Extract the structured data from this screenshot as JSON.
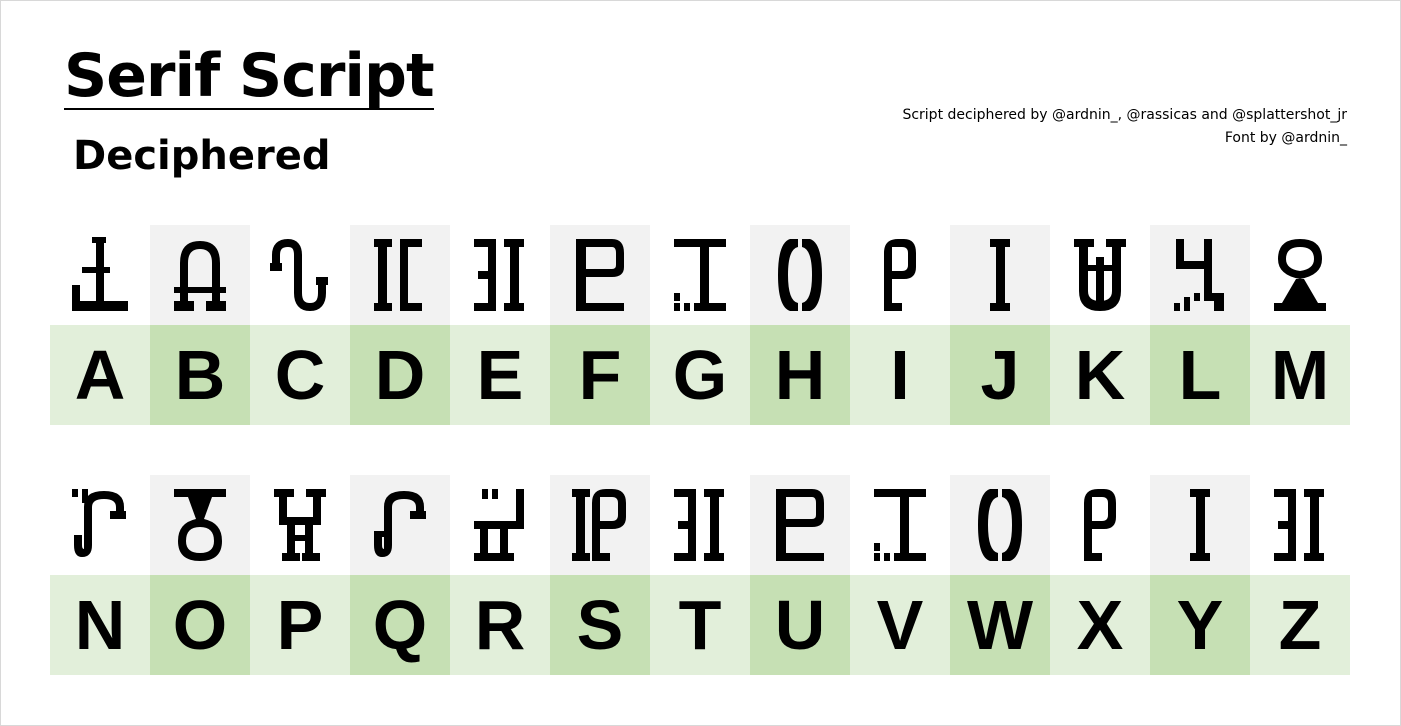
{
  "header": {
    "title": "Serif Script",
    "subtitle": "Deciphered",
    "credit_line_1": "Script deciphered by @ardnin_, @rassicas and @splattershot_jr",
    "credit_line_2": "Font by @ardnin_"
  },
  "colors": {
    "letter_cell_light": "#e2efda",
    "letter_cell_dark": "#c6e0b4",
    "glyph_cell_alt": "#f2f2f2"
  },
  "alphabet": {
    "row1": [
      "A",
      "B",
      "C",
      "D",
      "E",
      "F",
      "G",
      "H",
      "I",
      "J",
      "K",
      "L",
      "M"
    ],
    "row2": [
      "N",
      "O",
      "P",
      "Q",
      "R",
      "S",
      "T",
      "U",
      "V",
      "W",
      "X",
      "Y",
      "Z"
    ]
  }
}
